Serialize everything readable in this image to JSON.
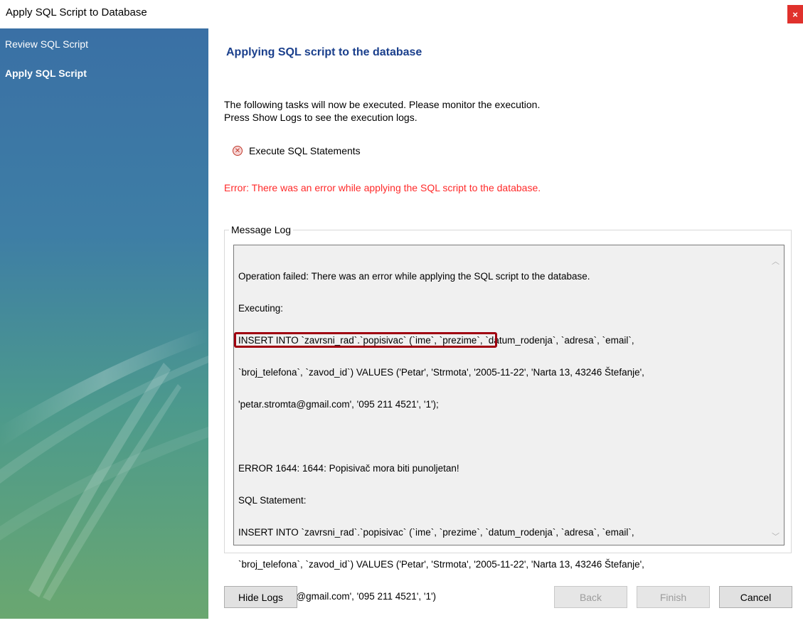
{
  "window": {
    "title": "Apply SQL Script to Database",
    "close_label": "×"
  },
  "sidebar": {
    "items": [
      {
        "label": "Review SQL Script",
        "active": false
      },
      {
        "label": "Apply SQL Script",
        "active": true
      }
    ]
  },
  "main": {
    "heading": "Applying SQL script to the database",
    "intro_line1": "The following tasks will now be executed. Please monitor the execution.",
    "intro_line2": "Press Show Logs to see the execution logs.",
    "task": {
      "label": "Execute SQL Statements",
      "icon": "error-icon",
      "status": "failed"
    },
    "error_message": "Error: There was an error while applying the SQL script to the database."
  },
  "message_log": {
    "label": "Message Log",
    "line1": "Operation failed: There was an error while applying the SQL script to the database.",
    "line2": "Executing:",
    "line3": "INSERT INTO `zavrsni_rad`.`popisivac` (`ime`, `prezime`, `datum_rodenja`, `adresa`, `email`,",
    "line4": "`broj_telefona`, `zavod_id`) VALUES ('Petar', 'Strmota', '2005-11-22', 'Narta 13, 43246 Štefanje',",
    "line5": "'petar.stromta@gmail.com', '095 211 4521', '1');",
    "line6": "",
    "line7": "ERROR 1644: 1644: Popisivač mora biti punoljetan!",
    "line8": "SQL Statement:",
    "line9": "INSERT INTO `zavrsni_rad`.`popisivac` (`ime`, `prezime`, `datum_rodenja`, `adresa`, `email`,",
    "line10": "`broj_telefona`, `zavod_id`) VALUES ('Petar', 'Strmota', '2005-11-22', 'Narta 13, 43246 Štefanje',",
    "line11": "'petar.stromta@gmail.com', '095 211 4521', '1')"
  },
  "buttons": {
    "hide_logs": "Hide Logs",
    "back": "Back",
    "finish": "Finish",
    "cancel": "Cancel"
  },
  "colors": {
    "heading": "#1a3f8c",
    "error": "#ff2a2a",
    "highlight": "#a00010",
    "close": "#e0312c"
  }
}
